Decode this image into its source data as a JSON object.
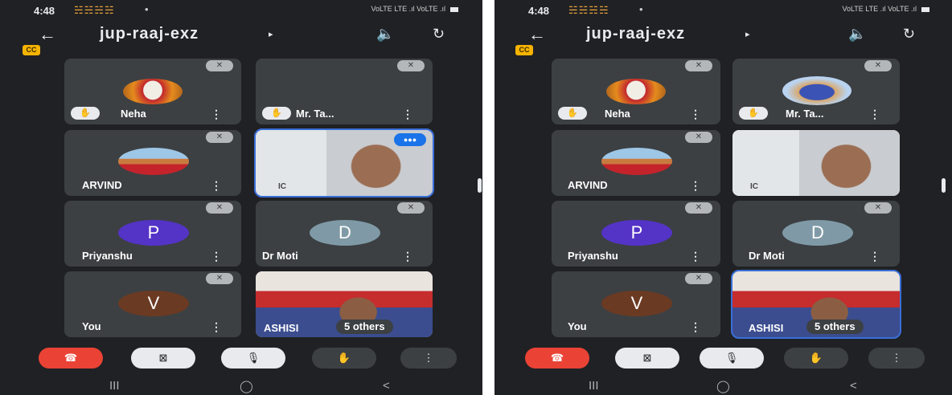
{
  "status_bar": {
    "time": "4:48",
    "notif_icons": "☵☵☵☵",
    "dot": "•",
    "signal": "VoLTE LTE .ıl VoLTE .ıl"
  },
  "call": {
    "title": "jup-raaj-exz",
    "title_arrow": "▸",
    "captions_badge": "CC"
  },
  "participants": [
    {
      "name": "Neha",
      "kind": "photo",
      "hand_raised": true
    },
    {
      "name": "Mr. Ta...",
      "kind": "photo",
      "hand_raised": true
    },
    {
      "name": "ARVIND",
      "kind": "photo",
      "hand_raised": false
    },
    {
      "name": "",
      "kind": "video",
      "hand_raised": false
    },
    {
      "name": "Priyanshu",
      "initial": "P",
      "color": "#5433c7"
    },
    {
      "name": "Dr Moti",
      "initial": "D",
      "color": "#7f9aa6"
    },
    {
      "name": "You",
      "initial": "V",
      "color": "#6b3a22"
    },
    {
      "name": "ASHISH",
      "kind": "video",
      "others": "5 others"
    }
  ],
  "labels": {
    "neha": "Neha",
    "mr_ta": "Mr. Ta...",
    "arvind": "ARVIND",
    "priyanshu": "Priyanshu",
    "dr_moti": "Dr Moti",
    "you": "You",
    "ashish": "ASHISI",
    "others": "5 others",
    "initial_p": "P",
    "initial_d": "D",
    "initial_v": "V",
    "menu": "⋮",
    "video_caption": "IC"
  },
  "controls": {
    "end_call": "☎",
    "camera_off": "⊠",
    "mic_off": "🎙",
    "raise_hand": "✋",
    "more": "⋮"
  },
  "nav": {
    "recents": "III",
    "home": "◯",
    "back": "<"
  },
  "colors": {
    "accent": "#1a73e8",
    "end_call": "#ea4335",
    "tile_bg": "#3c4043",
    "screen_bg": "#202124",
    "captions": "#f6b400"
  }
}
